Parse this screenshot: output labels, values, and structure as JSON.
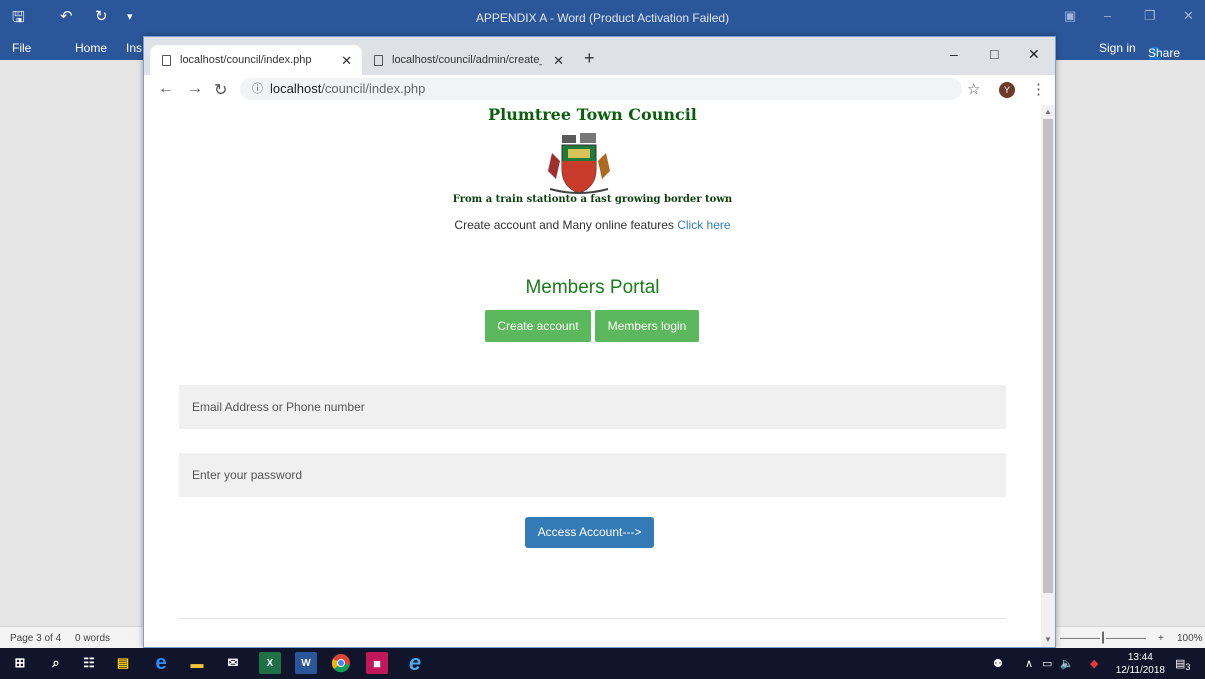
{
  "word": {
    "title": "APPENDIX A - Word (Product Activation Failed)",
    "ribbon": {
      "file": "File",
      "home": "Home",
      "insert_partial": "Ins",
      "sign_in": "Sign in",
      "share": "Share"
    },
    "status": {
      "page": "Page 3 of 4",
      "words": "0 words",
      "zoom": "100%"
    }
  },
  "browser": {
    "tabs": [
      {
        "title": "localhost/council/index.php",
        "active": true
      },
      {
        "title": "localhost/council/admin/create_",
        "active": false
      }
    ],
    "address": {
      "host": "localhost",
      "path": "/council/index.php"
    },
    "profile_initial": "Y"
  },
  "page": {
    "title": "Plumtree Town Council",
    "tagline": "From a train stationto a fast growing border town",
    "promo_text": "Create account and Many online features",
    "promo_link": "Click here",
    "portal_title": "Members Portal",
    "create_account_label": "Create account",
    "members_login_label": "Members login",
    "email_placeholder": "Email Address or Phone number",
    "password_placeholder": "Enter your  password",
    "submit_label": "Access Account--->"
  },
  "taskbar": {
    "time": "13:44",
    "date": "12/11/2018",
    "notifications": "3",
    "icons": [
      "windows-start-icon",
      "search-icon",
      "task-view-icon",
      "store-icon",
      "edge-icon",
      "file-explorer-icon",
      "mail-icon",
      "excel-icon",
      "word-icon",
      "chrome-icon",
      "app-icon",
      "internet-explorer-icon"
    ]
  },
  "colors": {
    "word_blue": "#2b579a",
    "title_green": "#0b5e0b",
    "button_green": "#5cb85c",
    "button_blue": "#337ab7",
    "link_blue": "#337ab7"
  }
}
